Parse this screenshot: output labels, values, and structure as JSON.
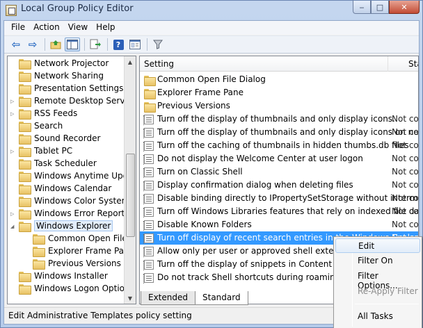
{
  "window": {
    "title": "Local Group Policy Editor"
  },
  "caption_buttons": {
    "minimize": "‒",
    "maximize": "□",
    "close": "✕"
  },
  "menu": [
    "File",
    "Action",
    "View",
    "Help"
  ],
  "toolbar": {
    "back_glyph": "⇦",
    "forward_glyph": "⇨",
    "help_glyph": "?"
  },
  "tree": {
    "items": [
      {
        "label": "Network Projector",
        "expandable": false
      },
      {
        "label": "Network Sharing",
        "expandable": false
      },
      {
        "label": "Presentation Settings",
        "expandable": false
      },
      {
        "label": "Remote Desktop Services",
        "expandable": true
      },
      {
        "label": "RSS Feeds",
        "expandable": true
      },
      {
        "label": "Search",
        "expandable": false
      },
      {
        "label": "Sound Recorder",
        "expandable": false
      },
      {
        "label": "Tablet PC",
        "expandable": true
      },
      {
        "label": "Task Scheduler",
        "expandable": false
      },
      {
        "label": "Windows Anytime Upgrade",
        "expandable": false
      },
      {
        "label": "Windows Calendar",
        "expandable": false
      },
      {
        "label": "Windows Color System",
        "expandable": false
      },
      {
        "label": "Windows Error Reporting",
        "expandable": true
      },
      {
        "label": "Windows Explorer",
        "expandable": true,
        "expanded": true,
        "selected": true
      },
      {
        "label": "Common Open File Dialog",
        "child": true
      },
      {
        "label": "Explorer Frame Pane",
        "child": true
      },
      {
        "label": "Previous Versions",
        "child": true
      },
      {
        "label": "Windows Installer",
        "expandable": false
      },
      {
        "label": "Windows Logon Options",
        "expandable": false
      }
    ]
  },
  "list": {
    "columns": {
      "setting": "Setting",
      "state": "State"
    },
    "rows": [
      {
        "type": "folder",
        "name": "Common Open File Dialog",
        "state": ""
      },
      {
        "type": "folder",
        "name": "Explorer Frame Pane",
        "state": ""
      },
      {
        "type": "folder",
        "name": "Previous Versions",
        "state": ""
      },
      {
        "type": "policy",
        "name": "Turn off the display of thumbnails and only display icons.",
        "state": "Not configured"
      },
      {
        "type": "policy",
        "name": "Turn off the display of thumbnails and only display icons on network folders",
        "state": "Not configured"
      },
      {
        "type": "policy",
        "name": "Turn off the caching of thumbnails in hidden thumbs.db files",
        "state": "Not configured"
      },
      {
        "type": "policy",
        "name": "Do not display the Welcome Center at user logon",
        "state": "Not configured"
      },
      {
        "type": "policy",
        "name": "Turn on Classic Shell",
        "state": "Not configured"
      },
      {
        "type": "policy",
        "name": "Display confirmation dialog when deleting files",
        "state": "Not configured"
      },
      {
        "type": "policy",
        "name": "Disable binding directly to IPropertySetStorage without intermediate layers",
        "state": "Not configured"
      },
      {
        "type": "policy",
        "name": "Turn off Windows Libraries features that rely on indexed file data",
        "state": "Not configured"
      },
      {
        "type": "policy",
        "name": "Disable Known Folders",
        "state": "Not configured"
      },
      {
        "type": "policy",
        "name": "Turn off display of recent search entries in the Windows Explorer search box",
        "state": "Not configured",
        "highlight": true
      },
      {
        "type": "policy",
        "name": "Allow only per user or approved shell extensions",
        "state": "Not configured"
      },
      {
        "type": "policy",
        "name": "Turn off the display of snippets in Content view mode",
        "state": "Not configured"
      },
      {
        "type": "policy",
        "name": "Do not track Shell shortcuts during roaming",
        "state": "Not configured"
      }
    ]
  },
  "tabs": [
    "Extended",
    "Standard"
  ],
  "active_tab": "Standard",
  "status": "Edit Administrative Templates policy setting",
  "context_menu": [
    {
      "label": "Edit",
      "hover": true
    },
    {
      "label": "Filter On"
    },
    {
      "label": "Filter Options..."
    },
    {
      "label": "Re-Apply Filter",
      "disabled": true
    },
    {
      "separator": true
    },
    {
      "label": "All Tasks"
    }
  ]
}
